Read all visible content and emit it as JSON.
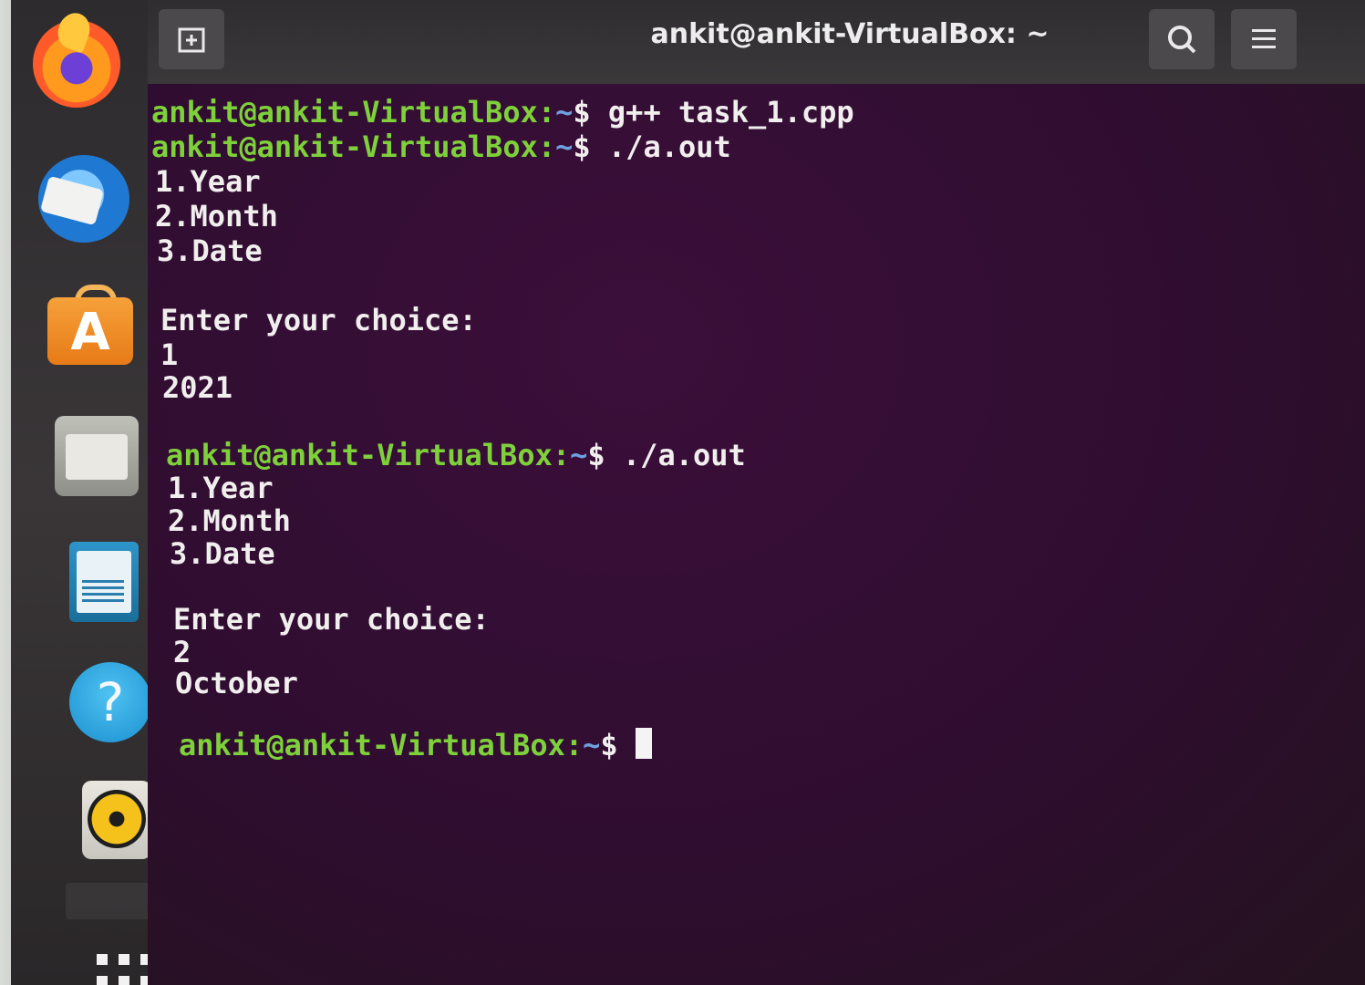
{
  "window": {
    "title": "ankit@ankit-VirtualBox: ~"
  },
  "dock": {
    "items": [
      {
        "name": "Firefox",
        "icon": "firefox-icon"
      },
      {
        "name": "Thunderbird",
        "icon": "thunderbird-icon"
      },
      {
        "name": "Ubuntu Software",
        "icon": "software-store-icon",
        "glyph": "A"
      },
      {
        "name": "Files",
        "icon": "files-folder-icon"
      },
      {
        "name": "LibreOffice Writer",
        "icon": "writer-document-icon"
      },
      {
        "name": "Help",
        "icon": "help-icon",
        "glyph": "?"
      },
      {
        "name": "Rhythmbox",
        "icon": "rhythmbox-icon"
      },
      {
        "name": "Show Applications",
        "icon": "apps-grid-icon"
      }
    ]
  },
  "terminal": {
    "prompt_user": "ankit@ankit-VirtualBox:",
    "prompt_dir": "~",
    "prompt_sym": "$",
    "lines": [
      {
        "kind": "prompt",
        "command": " g++ task_1.cpp"
      },
      {
        "kind": "prompt",
        "command": " ./a.out"
      },
      {
        "kind": "output",
        "text": "1.Year"
      },
      {
        "kind": "output",
        "text": "2.Month"
      },
      {
        "kind": "output",
        "text": "3.Date"
      },
      {
        "kind": "output",
        "text": "Enter your choice:"
      },
      {
        "kind": "output",
        "text": "1"
      },
      {
        "kind": "output",
        "text": "2021"
      },
      {
        "kind": "prompt",
        "command": " ./a.out"
      },
      {
        "kind": "output",
        "text": "1.Year"
      },
      {
        "kind": "output",
        "text": "2.Month"
      },
      {
        "kind": "output",
        "text": "3.Date"
      },
      {
        "kind": "output",
        "text": "Enter your choice:"
      },
      {
        "kind": "output",
        "text": "2"
      },
      {
        "kind": "output",
        "text": "October"
      },
      {
        "kind": "prompt",
        "command": " "
      }
    ]
  },
  "colors": {
    "prompt": "#7ed13a",
    "path": "#6fa0e0",
    "text": "#f1eeee",
    "background": "#300a24"
  }
}
